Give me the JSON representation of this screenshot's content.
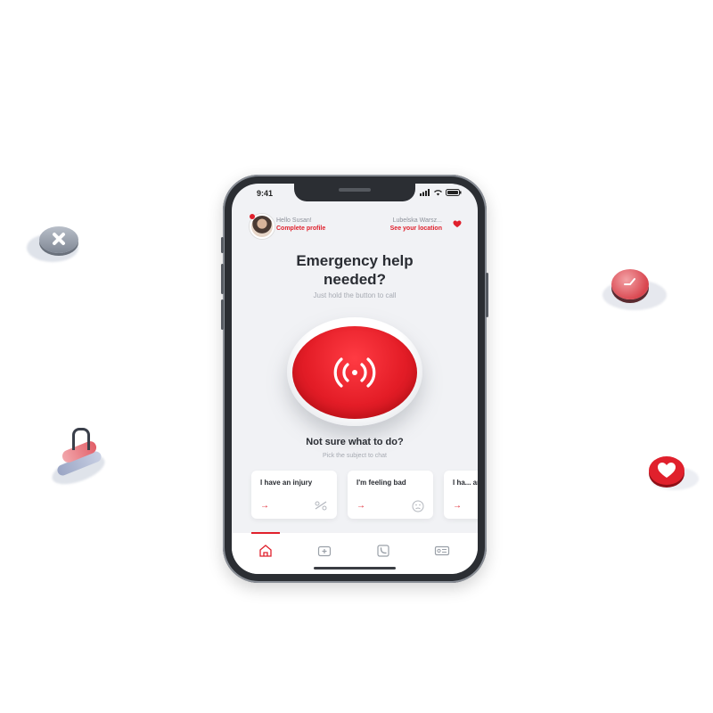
{
  "status": {
    "time": "9:41"
  },
  "header": {
    "greeting": "Hello Susan!",
    "profile_link": "Complete profile",
    "location_name": "Lubelska Warsz...",
    "location_link": "See your location"
  },
  "main": {
    "title_line1": "Emergency help",
    "title_line2": "needed?",
    "subtitle": "Just hold the button to call",
    "help_title": "Not sure what to do?",
    "help_subtitle": "Pick the subject to chat"
  },
  "cards": [
    {
      "label": "I have an injury",
      "icon": "bandage-icon"
    },
    {
      "label": "I'm feeling bad",
      "icon": "sad-face-icon"
    },
    {
      "label": "I ha... an i...",
      "icon": ""
    }
  ],
  "tabs": [
    {
      "name": "home",
      "icon": "home-icon",
      "active": true
    },
    {
      "name": "first-aid",
      "icon": "first-aid-icon",
      "active": false
    },
    {
      "name": "calls",
      "icon": "phone-icon",
      "active": false
    },
    {
      "name": "id-card",
      "icon": "id-card-icon",
      "active": false
    }
  ],
  "colors": {
    "accent": "#e0202c",
    "background": "#f1f2f5",
    "text": "#2a2d33",
    "muted": "#a6aab2"
  }
}
